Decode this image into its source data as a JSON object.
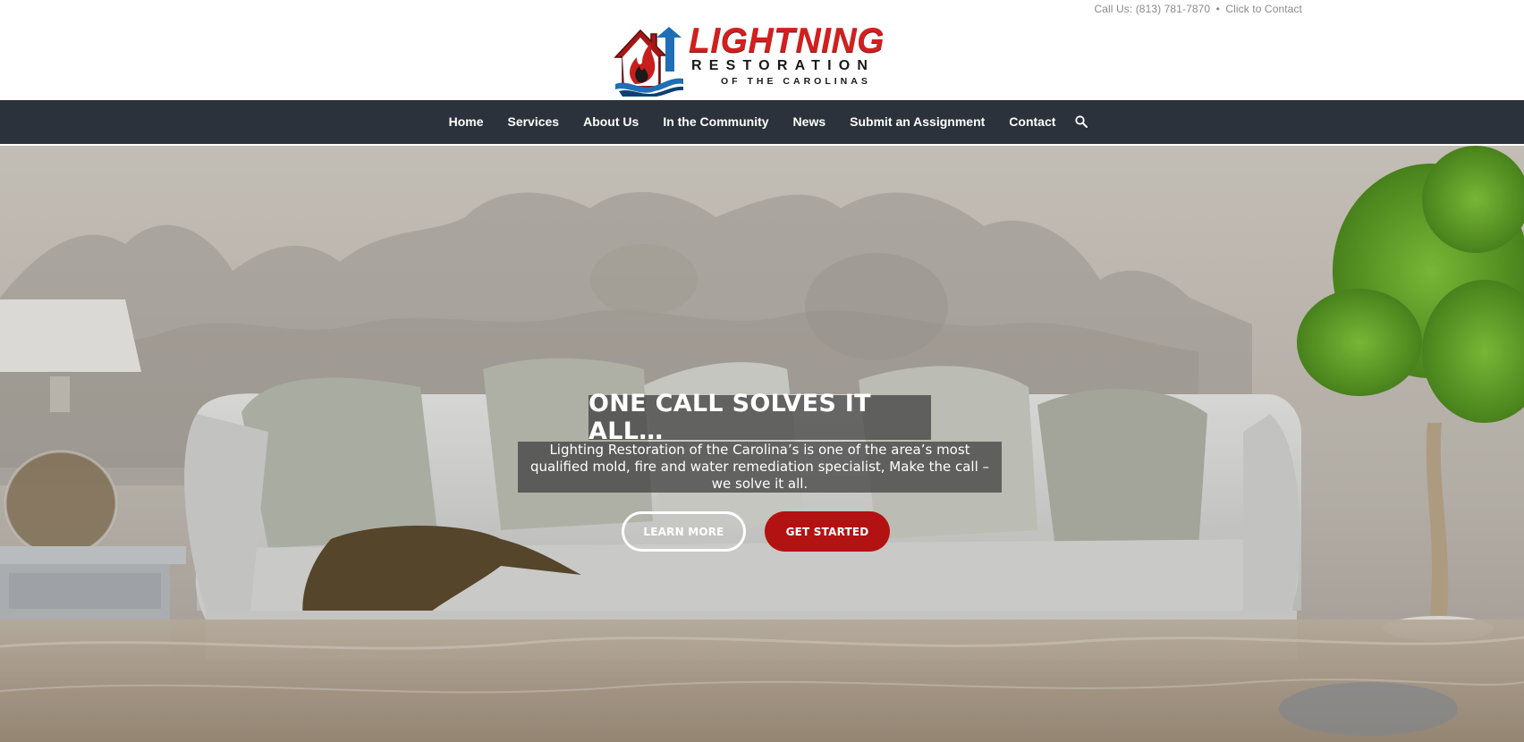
{
  "topbar": {
    "phone_text": "Call Us: (813) 781-7870",
    "separator": "•",
    "contact_link": "Click to Contact"
  },
  "logo": {
    "title": "LIGHTNING",
    "subtitle": "RESTORATION",
    "tagline": "OF THE CAROLINAS"
  },
  "nav": {
    "items": [
      {
        "label": "Home"
      },
      {
        "label": "Services"
      },
      {
        "label": "About Us"
      },
      {
        "label": "In the Community"
      },
      {
        "label": "News"
      },
      {
        "label": "Submit an Assignment"
      },
      {
        "label": "Contact"
      }
    ],
    "search_icon": "search-icon"
  },
  "hero": {
    "headline": "ONE CALL SOLVES IT ALL…",
    "description": "Lighting Restoration of the Carolina’s is one of the area’s most qualified mold, fire and water remediation specialist, Make the call – we solve it all.",
    "buttons": {
      "learn_more": "LEARN MORE",
      "get_started": "GET STARTED"
    }
  },
  "colors": {
    "nav_bg": "#2b323b",
    "brand_red": "#b31212",
    "logo_red": "#d21f1f",
    "logo_blue": "#1e6fb8"
  }
}
